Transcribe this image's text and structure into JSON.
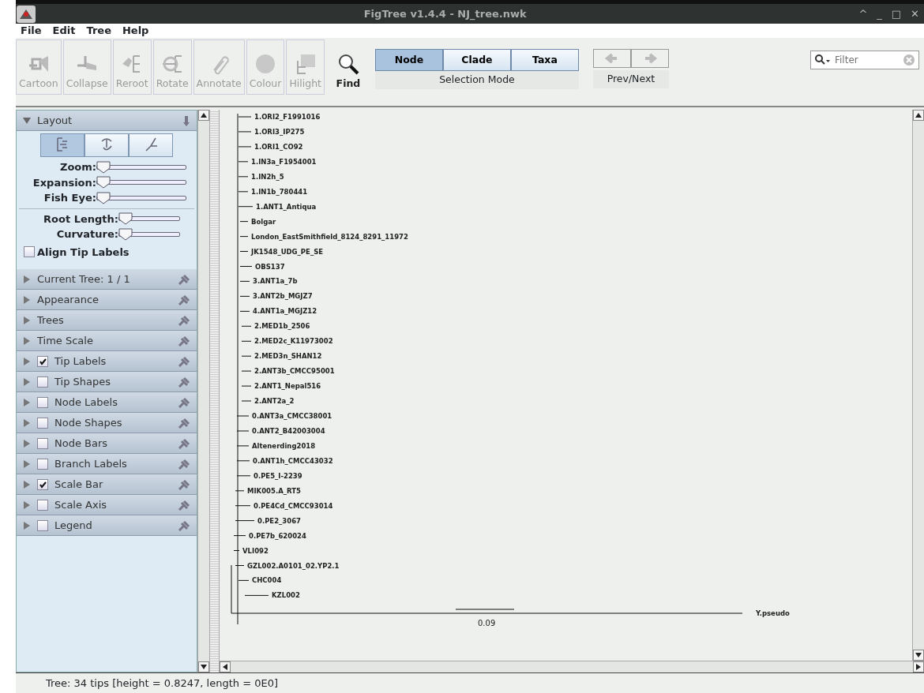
{
  "window": {
    "title": "FigTree v1.4.4 - NJ_tree.nwk",
    "controls": [
      "^",
      "_",
      "□",
      "✕"
    ]
  },
  "menu": [
    "File",
    "Edit",
    "Tree",
    "Help"
  ],
  "toolbar": [
    {
      "label": "Cartoon",
      "kind": "cartoon",
      "disabled": true
    },
    {
      "label": "Collapse",
      "kind": "collapse",
      "disabled": true
    },
    {
      "label": "Reroot",
      "kind": "reroot",
      "disabled": true
    },
    {
      "label": "Rotate",
      "kind": "rotate",
      "disabled": true
    },
    {
      "label": "Annotate",
      "kind": "annotate",
      "disabled": true
    },
    {
      "label": "Colour",
      "kind": "colour",
      "disabled": true
    },
    {
      "label": "Hilight",
      "kind": "hilight",
      "disabled": true
    },
    {
      "label": "Find",
      "kind": "find",
      "disabled": false
    }
  ],
  "selection_mode": {
    "label": "Selection Mode",
    "options": [
      {
        "label": "Node",
        "selected": true
      },
      {
        "label": "Clade",
        "selected": false
      },
      {
        "label": "Taxa",
        "selected": false
      }
    ]
  },
  "prev_next": {
    "label": "Prev/Next",
    "disabled": true
  },
  "filter": {
    "placeholder": "Filter"
  },
  "layout_panel": {
    "title": "Layout",
    "expanded": true,
    "layout_types": [
      {
        "kind": "rectangular",
        "selected": true
      },
      {
        "kind": "polar",
        "selected": false
      },
      {
        "kind": "radial",
        "selected": false
      }
    ],
    "sliders_a": [
      {
        "label": "Zoom:",
        "level": 0
      },
      {
        "label": "Expansion:",
        "level": 0
      },
      {
        "label": "Fish Eye:",
        "level": 0
      }
    ],
    "sliders_b": [
      {
        "label": "Root Length:",
        "level": 0
      },
      {
        "label": "Curvature:",
        "level": 0
      }
    ],
    "align_tip_labels": {
      "label": "Align Tip Labels",
      "checked": false
    }
  },
  "sections": [
    {
      "label": "Current Tree: 1 / 1",
      "kind": "plain"
    },
    {
      "label": "Appearance",
      "kind": "plain"
    },
    {
      "label": "Trees",
      "kind": "plain"
    },
    {
      "label": "Time Scale",
      "kind": "plain"
    },
    {
      "label": "Tip Labels",
      "kind": "checkbox",
      "checked": true
    },
    {
      "label": "Tip Shapes",
      "kind": "checkbox",
      "checked": false
    },
    {
      "label": "Node Labels",
      "kind": "checkbox",
      "checked": false
    },
    {
      "label": "Node Shapes",
      "kind": "checkbox",
      "checked": false
    },
    {
      "label": "Node Bars",
      "kind": "checkbox",
      "checked": false
    },
    {
      "label": "Branch Labels",
      "kind": "checkbox",
      "checked": false
    },
    {
      "label": "Scale Bar",
      "kind": "checkbox",
      "checked": true
    },
    {
      "label": "Scale Axis",
      "kind": "checkbox",
      "checked": false
    },
    {
      "label": "Legend",
      "kind": "checkbox",
      "checked": false
    }
  ],
  "tree": {
    "tips": [
      "1.ORI2_F1991016",
      "1.ORI3_IP275",
      "1.ORI1_CO92",
      "1.IN3a_F1954001",
      "1.IN2h_5",
      "1.IN1b_780441",
      "1.ANT1_Antiqua",
      "Bolgar",
      "London_EastSmithfield_8124_8291_11972",
      "JK1548_UDG_PE_SE",
      "OBS137",
      "3.ANT1a_7b",
      "3.ANT2b_MGJZ7",
      "4.ANT1a_MGJZ12",
      "2.MED1b_2506",
      "2.MED2c_K11973002",
      "2.MED3n_SHAN12",
      "2.ANT3b_CMCC95001",
      "2.ANT1_Nepal516",
      "2.ANT2a_2",
      "0.ANT3a_CMCC38001",
      "0.ANT2_B42003004",
      "Altenerding2018",
      "0.ANT1h_CMCC43032",
      "0.PE5_I-2239",
      "MIK005.A_RT5",
      "0.PE4Cd_CMCC93014",
      "0.PE2_3067",
      "0.PE7b_620024",
      "VLI092",
      "GZL002.A0101_02.YP2.1",
      "CHC004",
      "KZL002",
      "Y.pseudo"
    ],
    "scale_bar": "0.09"
  },
  "status_bar": "Tree: 34 tips [height = 0.8247, length = 0E0]"
}
